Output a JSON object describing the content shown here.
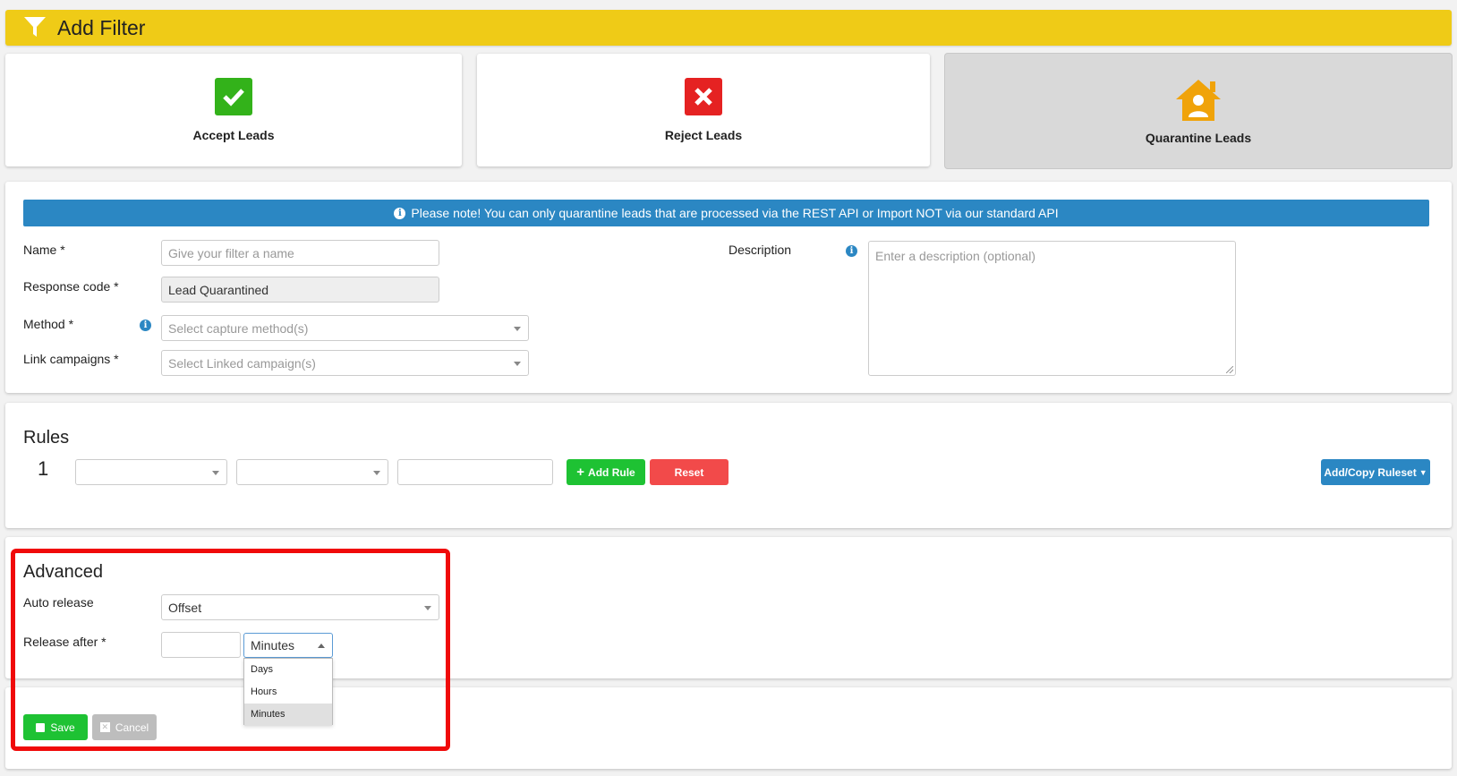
{
  "header": {
    "title": "Add Filter",
    "icon": "filter-icon"
  },
  "filter_types": [
    {
      "label": "Accept Leads",
      "icon": "check-icon",
      "color": "#33b21a"
    },
    {
      "label": "Reject Leads",
      "icon": "close-icon",
      "color": "#e52222"
    },
    {
      "label": "Quarantine Leads",
      "icon": "house-user-icon",
      "color": "#f0a30a",
      "selected": true
    }
  ],
  "notice": {
    "text": "Please note! You can only quarantine leads that are processed via the REST API or Import NOT via our standard API"
  },
  "form": {
    "name_label": "Name *",
    "name_placeholder": "Give your filter a name",
    "response_code_label": "Response code *",
    "response_code_value": "Lead Quarantined",
    "method_label": "Method *",
    "method_placeholder": "Select capture method(s)",
    "link_campaigns_label": "Link campaigns *",
    "link_campaigns_placeholder": "Select Linked campaign(s)",
    "description_label": "Description",
    "description_placeholder": "Enter a description (optional)"
  },
  "rules": {
    "title": "Rules",
    "rule_number": "1",
    "add_rule_label": "Add Rule",
    "reset_label": "Reset",
    "add_copy_ruleset_label": "Add/Copy Ruleset"
  },
  "advanced": {
    "title": "Advanced",
    "auto_release_label": "Auto release",
    "auto_release_value": "Offset",
    "release_after_label": "Release after *",
    "release_after_value": "",
    "unit_selected": "Minutes",
    "unit_options": [
      "Days",
      "Hours",
      "Minutes"
    ]
  },
  "actions": {
    "save_label": "Save",
    "cancel_label": "Cancel"
  },
  "colors": {
    "header": "#efcb17",
    "info_blue": "#2b87c3",
    "green": "#1ec233",
    "red": "#f24a4a",
    "highlight": "#f00a0a"
  }
}
